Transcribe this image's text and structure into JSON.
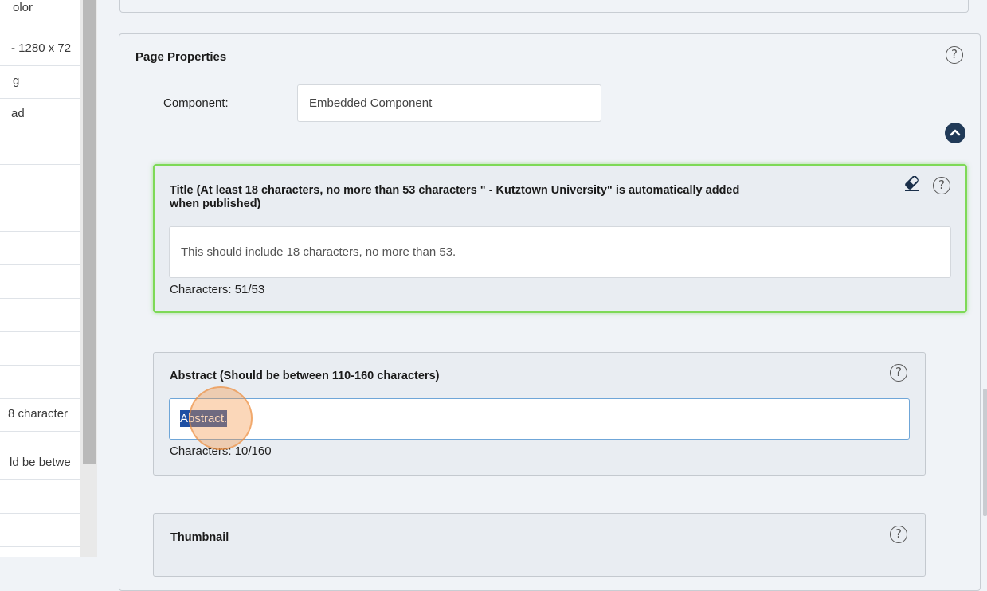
{
  "sidebar": {
    "items": [
      {
        "label": "olor"
      },
      {
        "label": "- 1280 x 72"
      },
      {
        "label": "g"
      },
      {
        "label": "ad"
      },
      {
        "label": ""
      },
      {
        "label": ""
      },
      {
        "label": ""
      },
      {
        "label": ""
      },
      {
        "label": ""
      },
      {
        "label": ""
      },
      {
        "label": ""
      },
      {
        "label": ""
      },
      {
        "label": "8 character"
      },
      {
        "label": "ld be betwe"
      },
      {
        "label": ""
      },
      {
        "label": ""
      },
      {
        "label": ""
      }
    ]
  },
  "page_properties": {
    "title": "Page Properties",
    "help_glyph": "?",
    "component_label": "Component:",
    "component_value": "Embedded Component",
    "collapse_icon": "chevron-up-icon"
  },
  "title_field": {
    "label": "Title (At least 18 characters, no more than 53 characters \" - Kutztown University\" is automatically added when published)",
    "value": "This should include 18 characters, no more than 53.",
    "count": "Characters: 51/53",
    "help_glyph": "?",
    "border_color": "#7ed957"
  },
  "abstract_field": {
    "label": "Abstract (Should be between 110-160 characters)",
    "value": "Abstract.",
    "count": "Characters: 10/160",
    "help_glyph": "?",
    "selection_color": "#1e4fa3"
  },
  "thumbnail_field": {
    "label": "Thumbnail",
    "help_glyph": "?"
  }
}
